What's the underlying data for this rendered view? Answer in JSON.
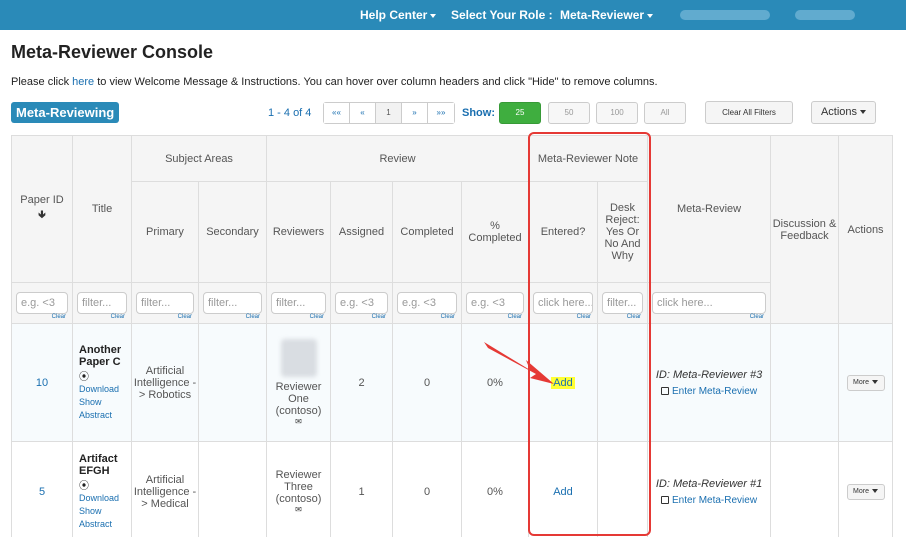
{
  "nav": {
    "help": "Help Center",
    "role_label": "Select Your Role :",
    "role_value": "Meta-Reviewer"
  },
  "page": {
    "title": "Meta-Reviewer Console",
    "intro_before": "Please click ",
    "intro_link": "here",
    "intro_after": " to view Welcome Message & Instructions. You can hover over column headers and click \"Hide\" to remove columns.",
    "badge": "Meta-Reviewing"
  },
  "toolbar": {
    "page_count": "1 - 4 of 4",
    "pager": [
      "««",
      "«",
      "1",
      "»",
      "»»"
    ],
    "show_label": "Show:",
    "show_options": [
      "25",
      "50",
      "100",
      "All"
    ],
    "clear_filters": "Clear All Filters",
    "actions": "Actions"
  },
  "table": {
    "headers": {
      "paper_id": "Paper ID",
      "title": "Title",
      "subject_areas": "Subject Areas",
      "primary": "Primary",
      "secondary": "Secondary",
      "review": "Review",
      "reviewers": "Reviewers",
      "assigned": "Assigned",
      "completed": "Completed",
      "pct_completed": "% Completed",
      "mr_note": "Meta-Reviewer Note",
      "entered": "Entered?",
      "desk_reject": "Desk Reject: Yes Or No And Why",
      "meta_review": "Meta-Review",
      "discussion": "Discussion & Feedback",
      "actions": "Actions"
    },
    "filters": {
      "paper_id": "e.g. <3",
      "title": "filter...",
      "primary": "filter...",
      "secondary": "filter...",
      "reviewers": "filter...",
      "assigned": "e.g. <3",
      "completed": "e.g. <3",
      "pct": "e.g. <3",
      "entered": "click here...",
      "desk": "filter...",
      "meta_review": "click here...",
      "clear": "Clear"
    },
    "rows": [
      {
        "id": "10",
        "title": "Another Paper C",
        "download": "Download",
        "abstract": "Show Abstract",
        "primary": "Artificial Intelligence -> Robotics",
        "reviewer": "Reviewer One (contoso)",
        "assigned": "2",
        "completed": "0",
        "pct": "0%",
        "add": "Add",
        "mr_id": "ID: Meta-Reviewer #3",
        "mr_link": "Enter Meta-Review",
        "more": "More"
      },
      {
        "id": "5",
        "title": "Artifact EFGH",
        "download": "Download",
        "abstract": "Show Abstract",
        "primary": "Artificial Intelligence -> Medical",
        "reviewer": "Reviewer Three (contoso)",
        "assigned": "1",
        "completed": "0",
        "pct": "0%",
        "add": "Add",
        "mr_id": "ID: Meta-Reviewer #1",
        "mr_link": "Enter Meta-Review",
        "more": "More"
      }
    ]
  },
  "colors": {
    "navbar": "#2a8ab8",
    "link": "#1a6fb0",
    "show_active": "#3fae3f",
    "highlight": "#ffff33",
    "annotation": "#e53935"
  }
}
